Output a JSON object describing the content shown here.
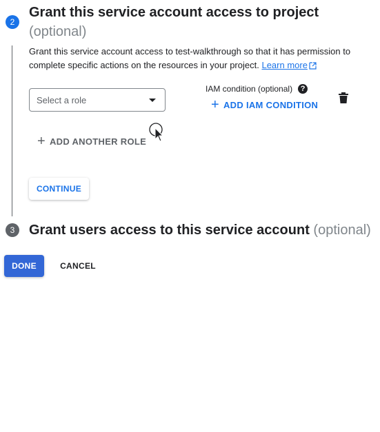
{
  "step2": {
    "number": "2",
    "title": "Grant this service account access to project",
    "optional": "(optional)",
    "description": "Grant this service account access to test-walkthrough so that it has permission to complete specific actions on the resources in your project.",
    "learn_more": "Learn more",
    "role_select_placeholder": "Select a role",
    "iam_condition_label": "IAM condition (optional)",
    "add_iam_condition": "ADD IAM CONDITION",
    "add_another_role": "ADD ANOTHER ROLE",
    "continue_label": "CONTINUE"
  },
  "step3": {
    "number": "3",
    "title": "Grant users access to this service account",
    "optional": "(optional)"
  },
  "actions": {
    "done": "DONE",
    "cancel": "CANCEL"
  },
  "colors": {
    "accent": "#1a73e8",
    "done_button": "#3367d6",
    "inactive_step": "#5f6368"
  },
  "icons": [
    "external-link-icon",
    "help-icon",
    "plus-icon",
    "delete-icon",
    "dropdown-arrow-icon",
    "mouse-cursor-icon"
  ]
}
